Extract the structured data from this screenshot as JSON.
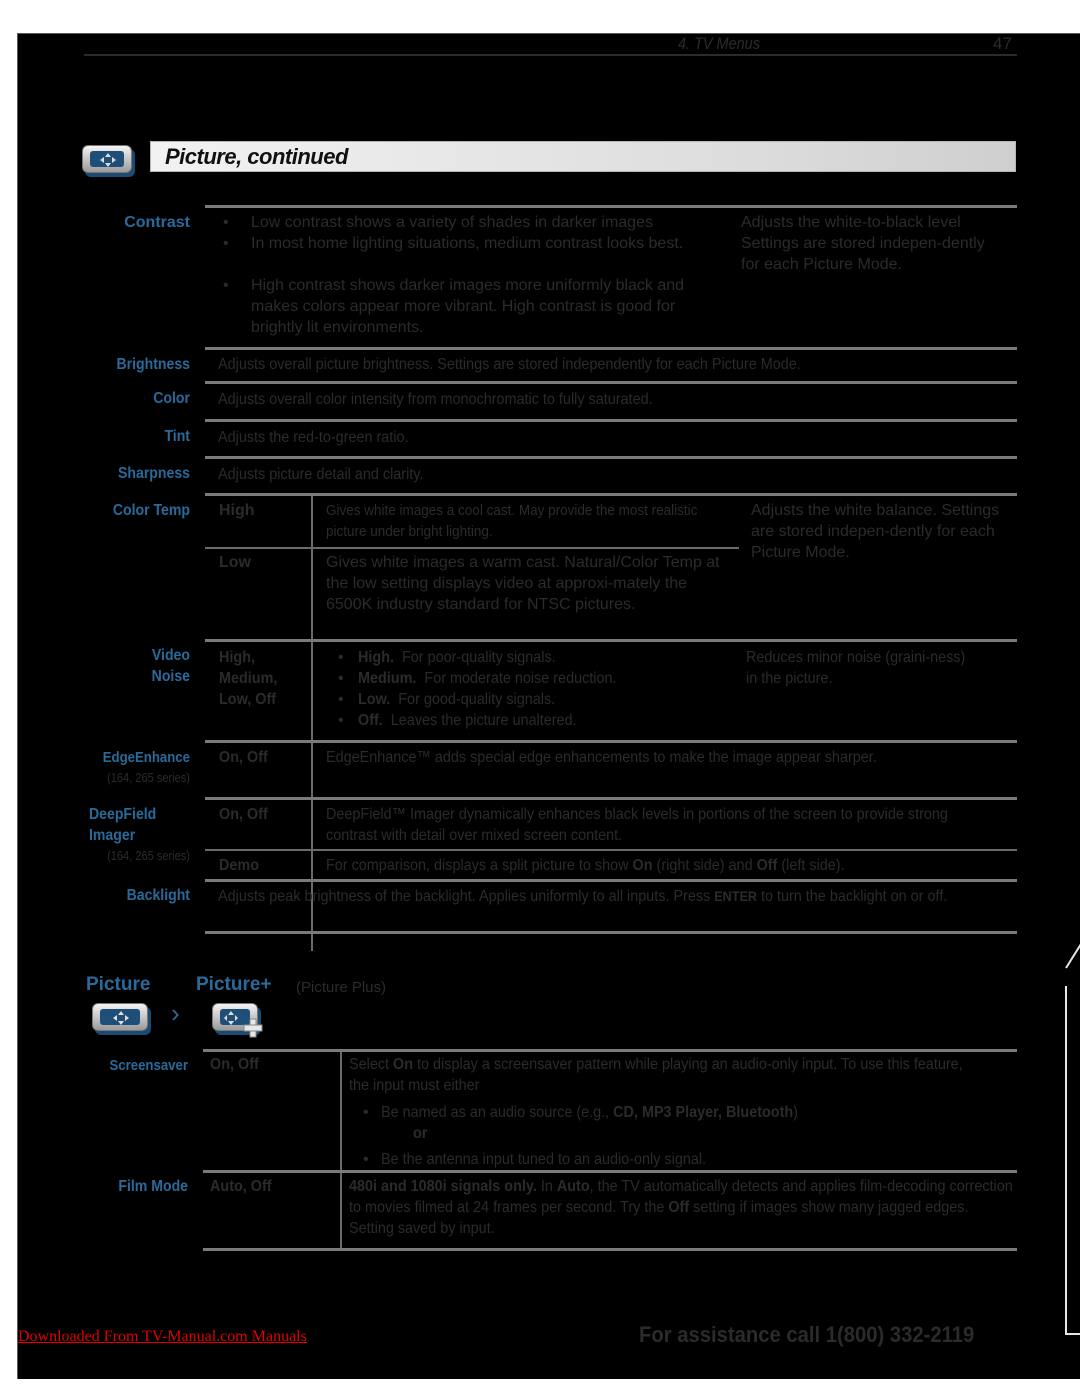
{
  "header": {
    "section": "4.  TV Menus",
    "page_number": "47"
  },
  "title": {
    "text": "Picture, continued",
    "icon": "picture-menu-icon"
  },
  "rows": {
    "contrast": {
      "label": "Contrast",
      "bullets": [
        "Low contrast shows a variety of shades in darker images",
        "In most home lighting situations, medium contrast looks best.",
        "High contrast shows darker images more uniformly black and makes colors appear more vibrant.  High contrast is good for brightly lit environments."
      ],
      "note": "Adjusts the white-to-black level Settings are stored indepen-dently for each Picture Mode."
    },
    "brightness": {
      "label": "Brightness",
      "text": "Adjusts overall picture brightness.  Settings are stored independently for each Picture Mode."
    },
    "color": {
      "label": "Color",
      "text": "Adjusts overall color intensity from monochromatic to fully saturated."
    },
    "tint": {
      "label": "Tint",
      "text": "Adjusts the red-to-green ratio."
    },
    "sharpness": {
      "label": "Sharpness",
      "text": "Adjusts picture detail and clarity."
    },
    "color_temp": {
      "label": "Color Temp",
      "options": [
        {
          "name": "High",
          "text": "Gives white images a cool cast.  May provide the most realistic picture under bright lighting."
        },
        {
          "name": "Low",
          "text": "Gives white images a warm cast.  Natural/Color Temp at the low setting displays video at approxi-mately the 6500K industry standard for NTSC pictures."
        }
      ],
      "note": "Adjusts the white balance. Settings are stored indepen-dently for each Picture Mode."
    },
    "video_noise": {
      "label_1": "Video",
      "label_2": "Noise",
      "options": "High, Medium, Low, Off",
      "bullets": [
        {
          "bold": "High.",
          "text": "For poor-quality signals."
        },
        {
          "bold": "Medium.",
          "text": "For moderate noise reduction."
        },
        {
          "bold": "Low.",
          "text": "For good-quality signals."
        },
        {
          "bold": "Off.",
          "text": "Leaves the picture unaltered."
        }
      ],
      "note": "Reduces minor noise (graini-ness) in the picture."
    },
    "edge_enhance": {
      "label": "EdgeEnhance",
      "sub": "(164, 265 series)",
      "options": "On, Off",
      "text": "EdgeEnhance™ adds special edge enhancements to make the image appear sharper."
    },
    "deepfield": {
      "label_1": "DeepField",
      "label_2": "Imager",
      "sub": "(164, 265 series)",
      "options": "On, Off",
      "text": "DeepField™ Imager dynamically enhances black levels in portions of the screen to provide strong contrast with detail over mixed screen content.",
      "demo": {
        "name": "Demo",
        "pre": "For comparison, displays a split picture to show ",
        "on": "On",
        "mid": " (right side) and ",
        "off": "Off",
        "post": " (left side)."
      }
    },
    "backlight": {
      "label": "Backlight",
      "pre": "Adjusts peak brightness of the backlight.  Applies uniformly to all inputs.  Press ",
      "key": "ENTER",
      "post": " to turn the backlight on or off."
    }
  },
  "picture_plus": {
    "breadcrumb_1": "Picture",
    "breadcrumb_2": "Picture+",
    "breadcrumb_note": "(Picture Plus)",
    "separator": "›",
    "screensaver": {
      "label": "Screensaver",
      "options": "On, Off",
      "intro_pre": "Select ",
      "intro_on": "On",
      "intro_post": " to display a screensaver pattern while playing an audio-only input.  To use this feature, the input must either",
      "bullet_1_pre": "Be named as an audio source (e.g., ",
      "bullet_1_bold": "CD, MP3 Player, Bluetooth",
      "bullet_1_post": ")",
      "or": "or",
      "bullet_2": "Be the antenna input tuned to an audio-only signal."
    },
    "film_mode": {
      "label": "Film Mode",
      "options": "Auto, Off",
      "bold_1": "480i and 1080i signals only.",
      "t1": "  In ",
      "bold_2": "Auto",
      "t2": ", the TV automatically detects and applies film-decoding correction to movies filmed at 24 frames per second.  Try the ",
      "bold_3": "Off",
      "t3": " setting if images show many jagged edges.  Setting saved by input."
    }
  },
  "footer": {
    "download_link": "Downloaded From TV-Manual.com Manuals",
    "assistance": "For assistance call 1(800) 332-2119"
  }
}
